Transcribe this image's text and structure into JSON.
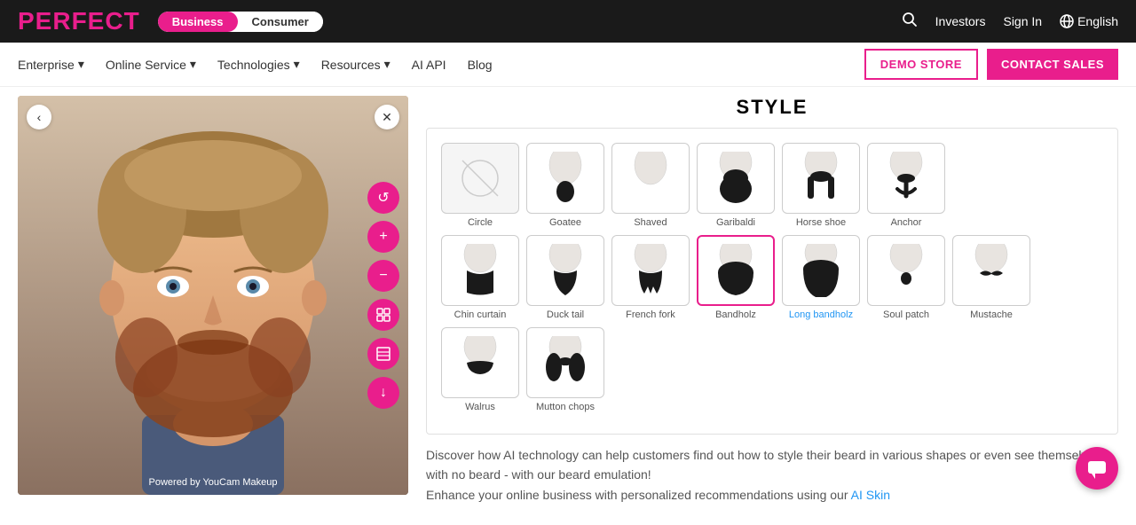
{
  "brand": {
    "logo": "PERFECT"
  },
  "topnav": {
    "toggle": {
      "business_label": "Business",
      "consumer_label": "Consumer",
      "active": "business"
    },
    "links": {
      "investors": "Investors",
      "signin": "Sign In",
      "language": "English"
    }
  },
  "secondnav": {
    "items": [
      {
        "label": "Enterprise",
        "has_dropdown": true
      },
      {
        "label": "Online Service",
        "has_dropdown": true
      },
      {
        "label": "Technologies",
        "has_dropdown": true
      },
      {
        "label": "Resources",
        "has_dropdown": true
      },
      {
        "label": "AI API",
        "has_dropdown": false
      },
      {
        "label": "Blog",
        "has_dropdown": false
      }
    ],
    "demo_btn": "DEMO STORE",
    "contact_btn": "CONTACT SALES"
  },
  "left_panel": {
    "powered_by": "Powered by YouCam Makeup"
  },
  "style_section": {
    "title": "STYLE",
    "items": [
      {
        "id": "circle",
        "label": "Circle",
        "disabled": true
      },
      {
        "id": "goatee",
        "label": "Goatee"
      },
      {
        "id": "shaved",
        "label": "Shaved"
      },
      {
        "id": "garibaldi",
        "label": "Garibaldi"
      },
      {
        "id": "horseshoe",
        "label": "Horse shoe"
      },
      {
        "id": "anchor",
        "label": "Anchor"
      },
      {
        "id": "chin_curtain",
        "label": "Chin curtain"
      },
      {
        "id": "duck_tail",
        "label": "Duck tail"
      },
      {
        "id": "french_fork",
        "label": "French fork"
      },
      {
        "id": "bandholz",
        "label": "Bandholz",
        "selected": true
      },
      {
        "id": "long_bandholz",
        "label": "Long bandholz",
        "blue": true
      },
      {
        "id": "soul_patch",
        "label": "Soul patch"
      },
      {
        "id": "mustache",
        "label": "Mustache"
      },
      {
        "id": "walrus",
        "label": "Walrus"
      },
      {
        "id": "mutton_chops",
        "label": "Mutton chops"
      }
    ]
  },
  "description": {
    "text1": "Discover how AI technology can help customers find out how to style their beard in various shapes or even see themselves with no beard - with our beard emulation!",
    "text2": "Enhance your online business with personalized recommendations using our",
    "link_text": "AI Skin"
  },
  "tools": [
    {
      "name": "reset",
      "icon": "↺"
    },
    {
      "name": "plus",
      "icon": "+"
    },
    {
      "name": "minus",
      "icon": "−"
    },
    {
      "name": "crop",
      "icon": "⊞"
    },
    {
      "name": "grid",
      "icon": "⊟"
    },
    {
      "name": "download",
      "icon": "↓"
    }
  ]
}
